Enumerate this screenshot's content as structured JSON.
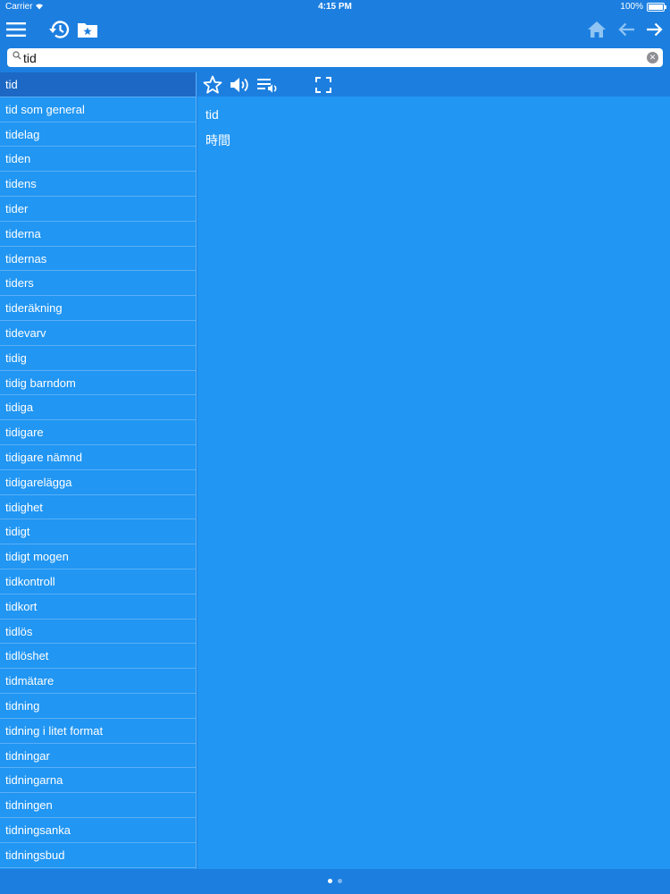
{
  "status": {
    "carrier": "Carrier",
    "time": "4:15 PM",
    "battery": "100%"
  },
  "toolbar": {
    "menu_icon": "hamburger-menu-icon",
    "history_icon": "history-clock-icon",
    "favorites_icon": "star-folder-icon",
    "home_icon": "home-icon",
    "back_icon": "arrow-left-icon",
    "forward_icon": "arrow-right-icon"
  },
  "search": {
    "value": "tid",
    "placeholder": ""
  },
  "list": {
    "selected_index": 0,
    "items": [
      "tid",
      "tid som general",
      "tidelag",
      "tiden",
      "tidens",
      "tider",
      "tiderna",
      "tidernas",
      "tiders",
      "tideräkning",
      "tidevarv",
      "tidig",
      "tidig barndom",
      "tidiga",
      "tidigare",
      "tidigare nämnd",
      "tidigarelägga",
      "tidighet",
      "tidigt",
      "tidigt mogen",
      "tidkontroll",
      "tidkort",
      "tidlös",
      "tidlöshet",
      "tidmätare",
      "tidning",
      "tidning i litet format",
      "tidningar",
      "tidningarna",
      "tidningen",
      "tidningsanka",
      "tidningsbud"
    ]
  },
  "detail": {
    "word": "tid",
    "translation": "時間",
    "tools": [
      "star-outline-icon",
      "speaker-icon",
      "playlist-audio-icon",
      "fullscreen-icon"
    ]
  },
  "pager": {
    "pages": 2,
    "current": 0
  },
  "colors": {
    "bar": "#1c7fe0",
    "panel": "#2196f3",
    "selected": "#1c68c4"
  }
}
